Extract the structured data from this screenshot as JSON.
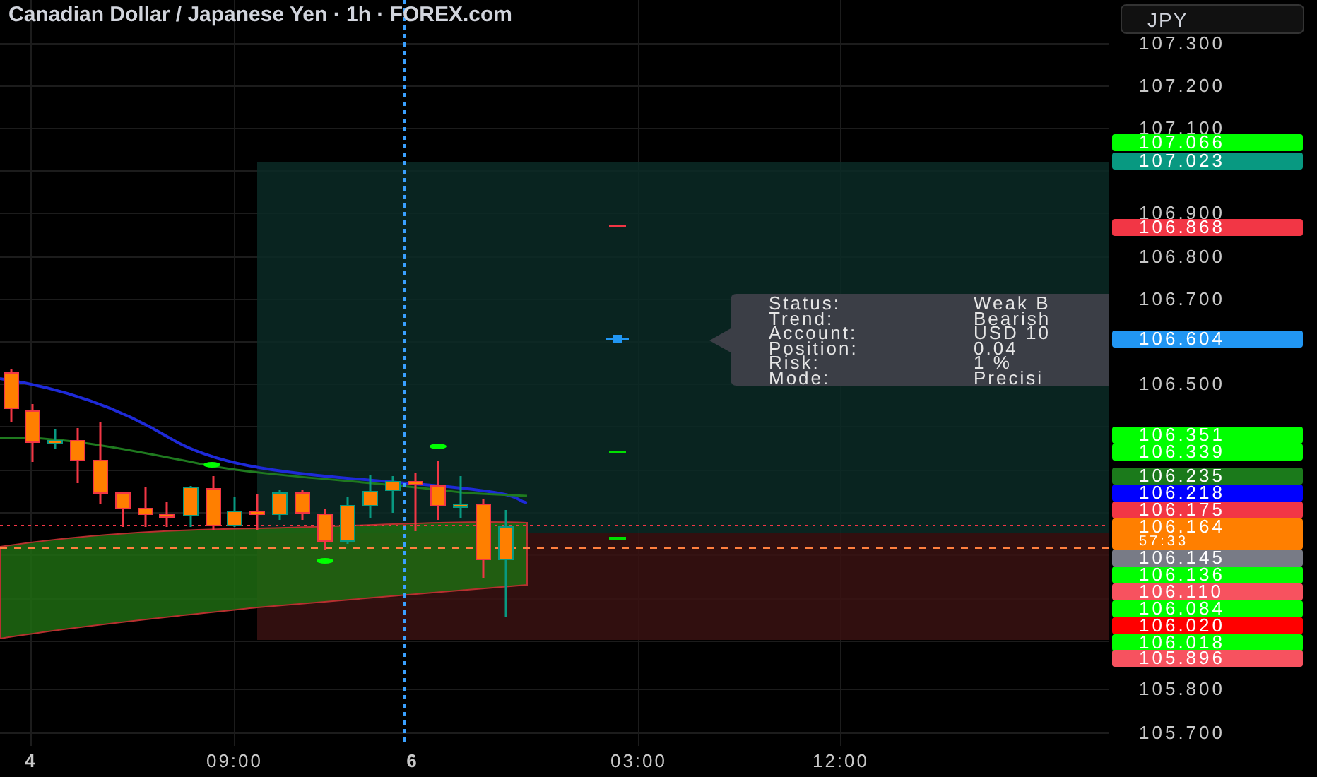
{
  "title": "Canadian Dollar / Japanese Yen · 1h · FOREX.com",
  "currency_button": "JPY",
  "price_labels": [
    "107.300",
    "107.200",
    "107.100",
    "106.900",
    "106.800",
    "106.700",
    "106.500",
    "105.800",
    "105.700"
  ],
  "price_tags": [
    {
      "text": "107.066",
      "color": "#00ff00"
    },
    {
      "text": "107.023",
      "color": "#089981"
    },
    {
      "text": "106.868",
      "color": "#f23645"
    },
    {
      "text": "106.604",
      "color": "#2196f3"
    },
    {
      "text": "106.351",
      "color": "#00ff00"
    },
    {
      "text": "106.339",
      "color": "#00ff00"
    },
    {
      "text": "106.235",
      "color": "#1b7a1b"
    },
    {
      "text": "106.218",
      "color": "#0000ff"
    },
    {
      "text": "106.175",
      "color": "#f23645"
    },
    {
      "text": "106.164",
      "color": "#ff7f00",
      "countdown": "57:33"
    },
    {
      "text": "106.145",
      "color": "#787b86"
    },
    {
      "text": "106.136",
      "color": "#00ff00"
    },
    {
      "text": "106.110",
      "color": "#f7525f"
    },
    {
      "text": "106.084",
      "color": "#00ff00"
    },
    {
      "text": "106.020",
      "color": "#ff0000"
    },
    {
      "text": "106.018",
      "color": "#00ff00"
    },
    {
      "text": "105.896",
      "color": "#f7525f"
    }
  ],
  "tooltip": {
    "rows": [
      {
        "label": "Status:",
        "value": "Weak B"
      },
      {
        "label": "Trend:",
        "value": "Bearish"
      },
      {
        "label": "Account:",
        "value": "USD 10"
      },
      {
        "label": "Position:",
        "value": "0.04"
      },
      {
        "label": "Risk:",
        "value": "1 %"
      },
      {
        "label": "Mode:",
        "value": "Precisi"
      }
    ]
  },
  "time_labels": [
    "4",
    "09:00",
    "6",
    "03:00",
    "12:00"
  ]
}
